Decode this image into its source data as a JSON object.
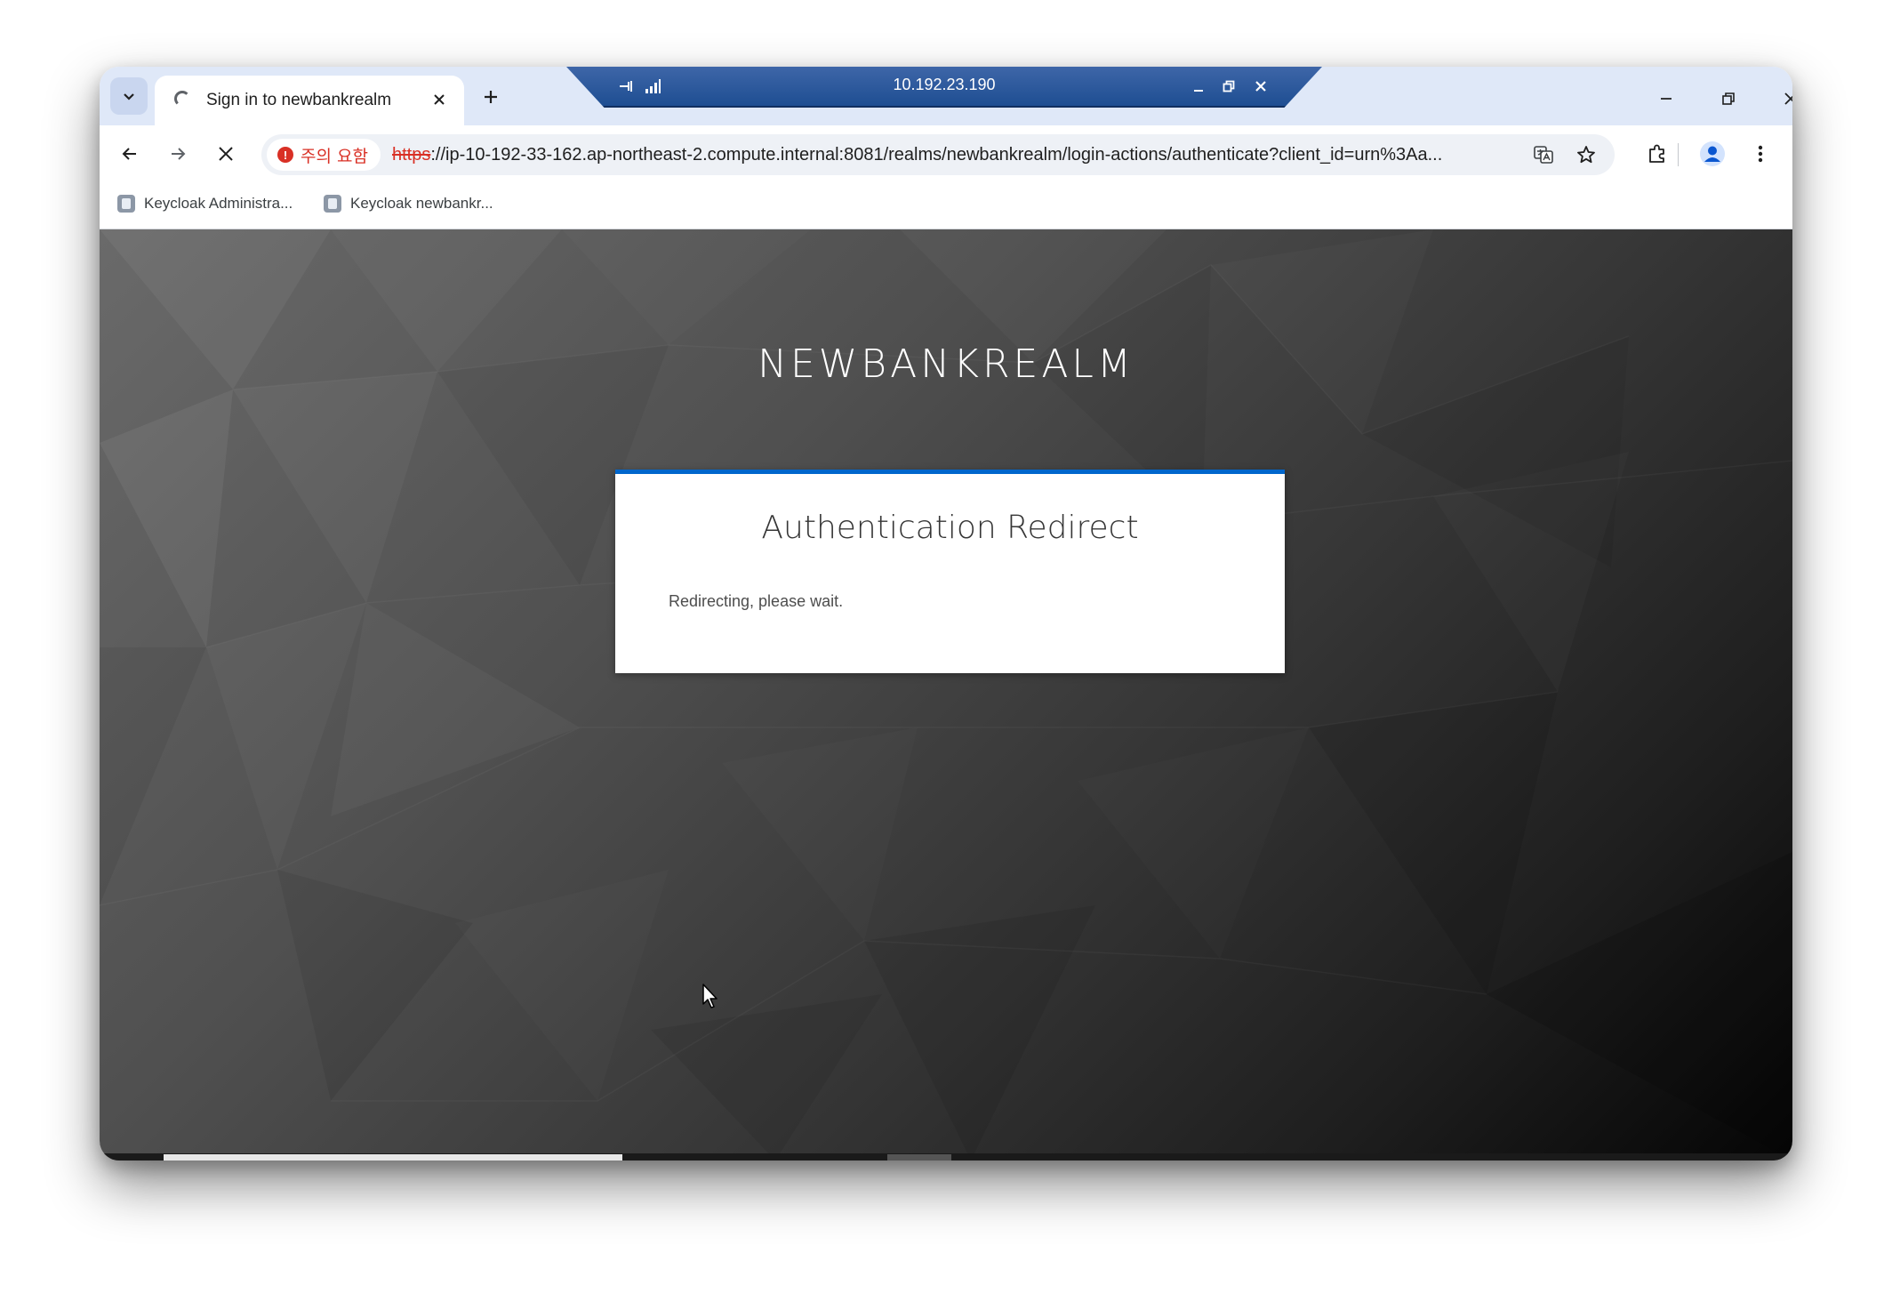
{
  "browser": {
    "tab": {
      "title": "Sign in to newbankrealm",
      "loading": true
    },
    "remote_session": {
      "host": "10.192.23.190"
    },
    "address_bar": {
      "security_chip": "주의 요함",
      "url_scheme": "https",
      "url_rest": "://ip-10-192-33-162.ap-northeast-2.compute.internal:8081/realms/newbankrealm/login-actions/authenticate?client_id=urn%3Aa..."
    },
    "bookmarks": [
      {
        "label": "Keycloak Administra..."
      },
      {
        "label": "Keycloak newbankr..."
      }
    ]
  },
  "page": {
    "realm_name": "NEWBANKREALM",
    "card": {
      "title": "Authentication Redirect",
      "message": "Redirecting, please wait."
    }
  },
  "colors": {
    "accent": "#0066cc",
    "warning": "#d93025",
    "tab_strip": "#dfe8f8",
    "rdp_bar": "#1e4e92"
  }
}
